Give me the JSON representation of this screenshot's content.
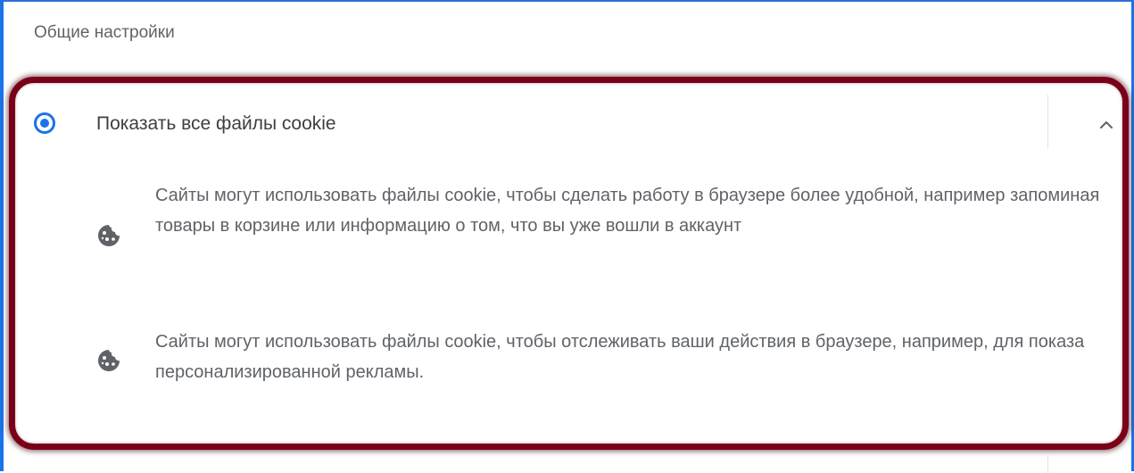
{
  "section": {
    "title": "Общие настройки"
  },
  "option": {
    "label": "Показать все файлы cookie",
    "selected": true,
    "expanded": true
  },
  "details": [
    {
      "icon": "cookie-icon",
      "text": "Сайты могут использовать файлы cookie, чтобы сделать работу в браузере более удобной, например запоминая товары в корзине или информацию о том, что вы уже вошли в аккаунт"
    },
    {
      "icon": "cookie-icon",
      "text": "Сайты могут использовать файлы cookie, чтобы отслеживать ваши действия в браузере, например, для показа персонализированной рекламы."
    }
  ],
  "colors": {
    "accent": "#1a73e8",
    "highlight_border": "#7a0019",
    "text_primary": "#3c4043",
    "text_secondary": "#5f6368"
  }
}
